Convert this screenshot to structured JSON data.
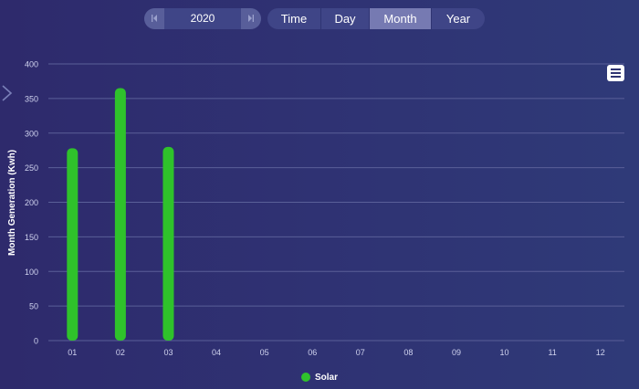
{
  "year_picker": {
    "value": "2020",
    "prev_icon": "prev-year-icon",
    "next_icon": "next-year-icon"
  },
  "period_tabs": [
    {
      "label": "Time",
      "active": false
    },
    {
      "label": "Day",
      "active": false
    },
    {
      "label": "Month",
      "active": true
    },
    {
      "label": "Year",
      "active": false
    }
  ],
  "menu_icon": "hamburger-menu-icon",
  "side_toggle_icon": "chevron-right-icon",
  "colors": {
    "solar": "#2fc22b",
    "grid": "#5a5f98",
    "axis_text": "#cfd2ee",
    "segment_active": "#767ab2"
  },
  "chart_data": {
    "type": "bar",
    "ylabel": "Month Generation (Kwh)",
    "xlabel": "",
    "categories": [
      "01",
      "02",
      "03",
      "04",
      "05",
      "06",
      "07",
      "08",
      "09",
      "10",
      "11",
      "12"
    ],
    "yticks": [
      0,
      50,
      100,
      150,
      200,
      250,
      300,
      350,
      400
    ],
    "ylim": [
      0,
      400
    ],
    "grid": true,
    "legend_position": "bottom",
    "series": [
      {
        "name": "Solar",
        "values": [
          278,
          365,
          280,
          null,
          null,
          null,
          null,
          null,
          null,
          null,
          null,
          null
        ]
      }
    ]
  }
}
